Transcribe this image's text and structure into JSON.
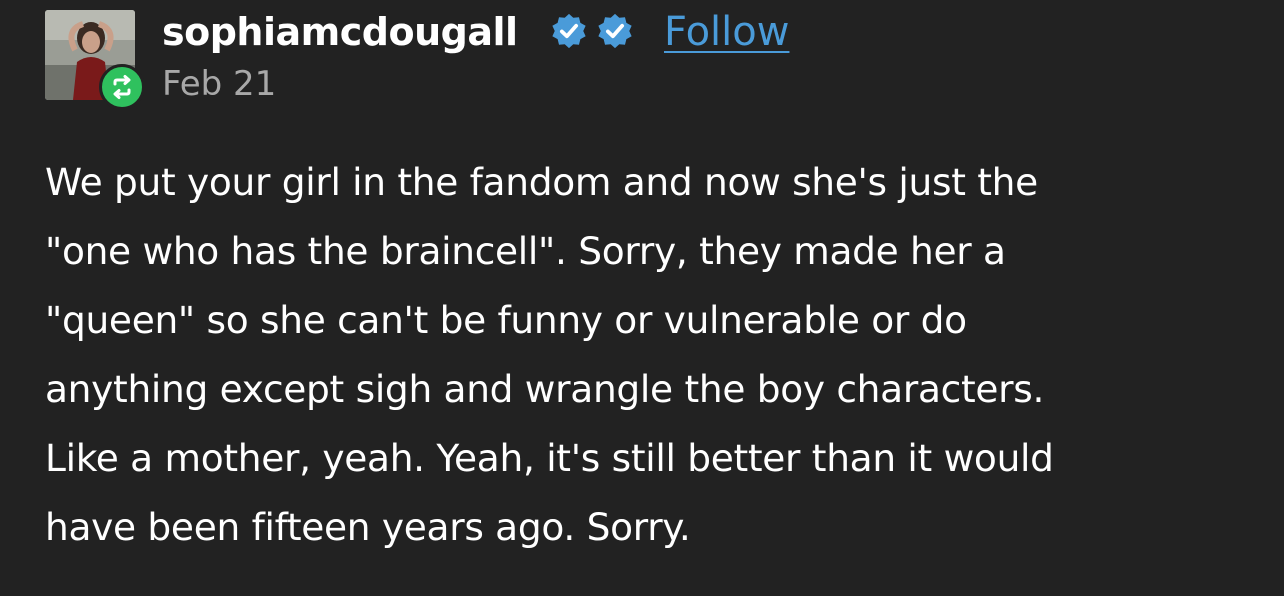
{
  "post": {
    "author": {
      "username": "sophiamcdougall",
      "avatar_icon": "user-photo-avatar",
      "reblog_icon": "reblog-icon",
      "verified_icon": "verified-badge-icon",
      "follow_label": "Follow"
    },
    "date": "Feb 21",
    "body_lines": [
      "We put your girl in the fandom and now she's just the",
      "\"one who has the braincell\". Sorry, they made her a",
      "\"queen\" so she can't be funny or vulnerable or do",
      "anything except sigh and wrangle the boy characters.",
      "Like a mother, yeah. Yeah, it's still better than it would",
      "have been fifteen years ago. Sorry."
    ]
  },
  "colors": {
    "background": "#222222",
    "text": "#ffffff",
    "muted": "#a8a8a8",
    "link": "#4a9bd9",
    "verified": "#4a9bd9",
    "reblog": "#2fc15e"
  }
}
